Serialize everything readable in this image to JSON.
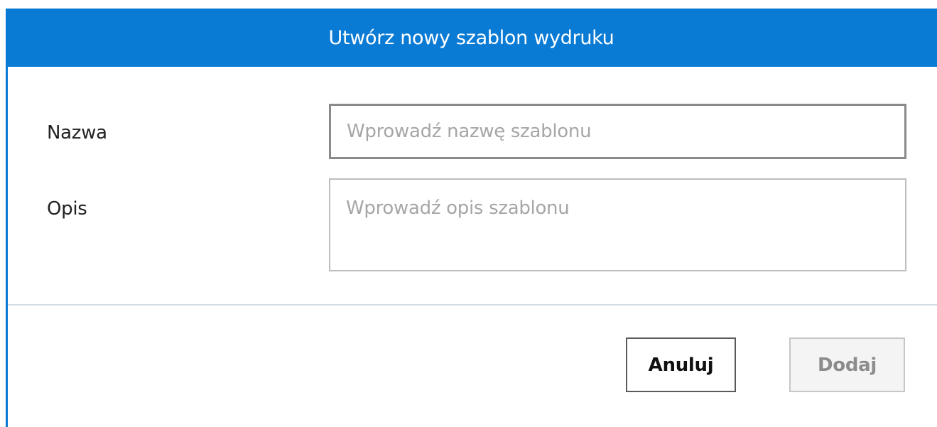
{
  "dialog": {
    "title": "Utwórz nowy szablon wydruku"
  },
  "form": {
    "name_label": "Nazwa",
    "name_value": "",
    "name_placeholder": "Wprowadź nazwę szablonu",
    "description_label": "Opis",
    "description_value": "",
    "description_placeholder": "Wprowadź opis szablonu"
  },
  "footer": {
    "cancel_label": "Anuluj",
    "add_label": "Dodaj",
    "add_enabled": false
  },
  "colors": {
    "accent": "#0a7bd4",
    "title_text": "#ffffff",
    "placeholder": "#a6a6a6",
    "disabled_text": "#8c8c8c"
  }
}
